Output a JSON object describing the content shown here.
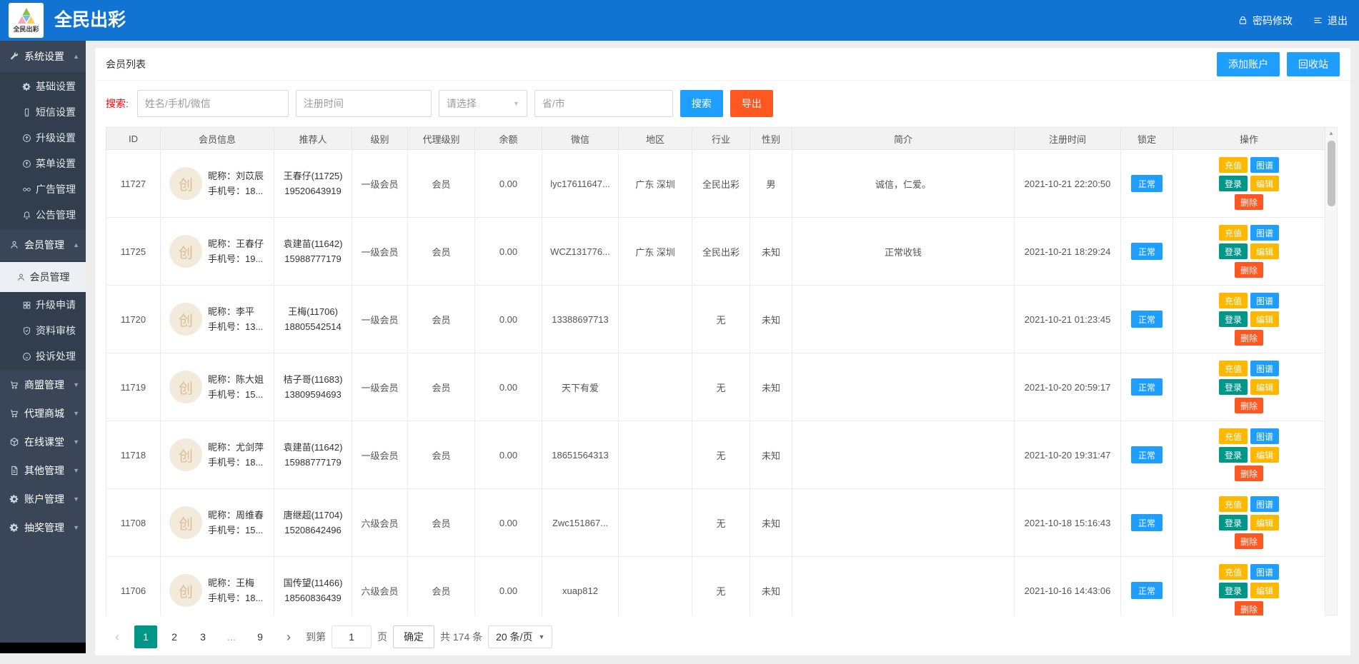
{
  "app": {
    "logo_text": "全民出彩",
    "title": "全民出彩"
  },
  "topbar": {
    "password_label": "密码修改",
    "logout_label": "退出"
  },
  "sidebar": {
    "items": [
      {
        "label": "系统设置",
        "icon": "wrench-icon",
        "type": "group",
        "state": "expanded"
      },
      {
        "label": "基础设置",
        "icon": "gear-icon",
        "type": "sub"
      },
      {
        "label": "短信设置",
        "icon": "mobile-icon",
        "type": "sub"
      },
      {
        "label": "升级设置",
        "icon": "arrow-up-circle-icon",
        "type": "sub"
      },
      {
        "label": "菜单设置",
        "icon": "arrow-up-circle-icon",
        "type": "sub"
      },
      {
        "label": "广告管理",
        "icon": "infinity-icon",
        "type": "sub"
      },
      {
        "label": "公告管理",
        "icon": "bell-icon",
        "type": "sub"
      },
      {
        "label": "会员管理",
        "icon": "user-icon",
        "type": "group",
        "state": "expanded"
      },
      {
        "label": "会员管理",
        "icon": "person-icon",
        "type": "sub",
        "active": true
      },
      {
        "label": "升级申请",
        "icon": "grid-icon",
        "type": "sub"
      },
      {
        "label": "资料审核",
        "icon": "shield-check-icon",
        "type": "sub"
      },
      {
        "label": "投诉处理",
        "icon": "frown-icon",
        "type": "sub"
      },
      {
        "label": "商盟管理",
        "icon": "cart-icon",
        "type": "group",
        "state": "collapsed"
      },
      {
        "label": "代理商城",
        "icon": "cart-icon",
        "type": "group",
        "state": "collapsed"
      },
      {
        "label": "在线课堂",
        "icon": "cube-icon",
        "type": "group",
        "state": "collapsed"
      },
      {
        "label": "其他管理",
        "icon": "file-icon",
        "type": "group",
        "state": "collapsed"
      },
      {
        "label": "账户管理",
        "icon": "gear-icon",
        "type": "group",
        "state": "collapsed"
      },
      {
        "label": "抽奖管理",
        "icon": "gear-icon",
        "type": "group",
        "state": "collapsed"
      }
    ]
  },
  "page": {
    "title": "会员列表",
    "add_account_label": "添加账户",
    "recycle_label": "回收站"
  },
  "search": {
    "label": "搜索:",
    "name_placeholder": "姓名/手机/微信",
    "time_placeholder": "注册时间",
    "select_placeholder": "请选择",
    "region_placeholder": "省/市",
    "search_label": "搜索",
    "export_label": "导出"
  },
  "table": {
    "headers": [
      "ID",
      "会员信息",
      "推荐人",
      "级别",
      "代理级别",
      "余额",
      "微信",
      "地区",
      "行业",
      "性别",
      "简介",
      "注册时间",
      "锁定",
      "操作"
    ],
    "avatar_char": "创",
    "actions": {
      "recharge": "充值",
      "atlas": "图谱",
      "login": "登录",
      "edit": "编辑",
      "delete": "删除"
    },
    "rows": [
      {
        "id": "11727",
        "nick": "昵称：刘苡辰",
        "phone": "手机号：18...",
        "referrer": "王春仔(11725)",
        "referrer_phone": "19520643919",
        "level": "一级会员",
        "agent_level": "会员",
        "balance": "0.00",
        "wechat": "lyc17611647...",
        "region": "广东 深圳",
        "industry": "全民出彩",
        "gender": "男",
        "intro": "诚信，仁爱。",
        "reg_time": "2021-10-21 22:20:50",
        "lock": "正常"
      },
      {
        "id": "11725",
        "nick": "昵称：王春仔",
        "phone": "手机号：19...",
        "referrer": "袁建苗(11642)",
        "referrer_phone": "15988777179",
        "level": "一级会员",
        "agent_level": "会员",
        "balance": "0.00",
        "wechat": "WCZ131776...",
        "region": "广东 深圳",
        "industry": "全民出彩",
        "gender": "未知",
        "intro": "正常收钱",
        "reg_time": "2021-10-21 18:29:24",
        "lock": "正常"
      },
      {
        "id": "11720",
        "nick": "昵称：李平",
        "phone": "手机号：13...",
        "referrer": "王梅(11706)",
        "referrer_phone": "18805542514",
        "level": "一级会员",
        "agent_level": "会员",
        "balance": "0.00",
        "wechat": "13388697713",
        "region": "",
        "industry": "无",
        "gender": "未知",
        "intro": "",
        "reg_time": "2021-10-21 01:23:45",
        "lock": "正常"
      },
      {
        "id": "11719",
        "nick": "昵称：陈大姐",
        "phone": "手机号：15...",
        "referrer": "桔子哥(11683)",
        "referrer_phone": "13809594693",
        "level": "一级会员",
        "agent_level": "会员",
        "balance": "0.00",
        "wechat": "天下有爱",
        "region": "",
        "industry": "无",
        "gender": "未知",
        "intro": "",
        "reg_time": "2021-10-20 20:59:17",
        "lock": "正常"
      },
      {
        "id": "11718",
        "nick": "昵称：尤剑萍",
        "phone": "手机号：18...",
        "referrer": "袁建苗(11642)",
        "referrer_phone": "15988777179",
        "level": "一级会员",
        "agent_level": "会员",
        "balance": "0.00",
        "wechat": "18651564313",
        "region": "",
        "industry": "无",
        "gender": "未知",
        "intro": "",
        "reg_time": "2021-10-20 19:31:47",
        "lock": "正常"
      },
      {
        "id": "11708",
        "nick": "昵称：周维春",
        "phone": "手机号：15...",
        "referrer": "唐继超(11704)",
        "referrer_phone": "15208642496",
        "level": "六级会员",
        "agent_level": "会员",
        "balance": "0.00",
        "wechat": "Zwc151867...",
        "region": "",
        "industry": "无",
        "gender": "未知",
        "intro": "",
        "reg_time": "2021-10-18 15:16:43",
        "lock": "正常"
      },
      {
        "id": "11706",
        "nick": "昵称：王梅",
        "phone": "手机号：18...",
        "referrer": "国传望(11466)",
        "referrer_phone": "18560836439",
        "level": "六级会员",
        "agent_level": "会员",
        "balance": "0.00",
        "wechat": "xuap812",
        "region": "",
        "industry": "无",
        "gender": "未知",
        "intro": "",
        "reg_time": "2021-10-16 14:43:06",
        "lock": "正常"
      }
    ]
  },
  "pagination": {
    "pages": [
      "1",
      "2",
      "3",
      "...",
      "9"
    ],
    "active_page": "1",
    "goto_prefix": "到第",
    "goto_value": "1",
    "goto_suffix": "页",
    "confirm_label": "确定",
    "total_label": "共 174 条",
    "page_size_label": "20 条/页"
  },
  "colors": {
    "header_bg": "#1274D2",
    "primary": "#1E9FFF",
    "success": "#009688",
    "warning": "#FFB800",
    "danger": "#FF5722",
    "sidebar_bg": "#3A4657",
    "sidebar_sub_bg": "#323D4D",
    "active_item_bg": "#ECEFF3",
    "search_label": "#FF0000"
  }
}
